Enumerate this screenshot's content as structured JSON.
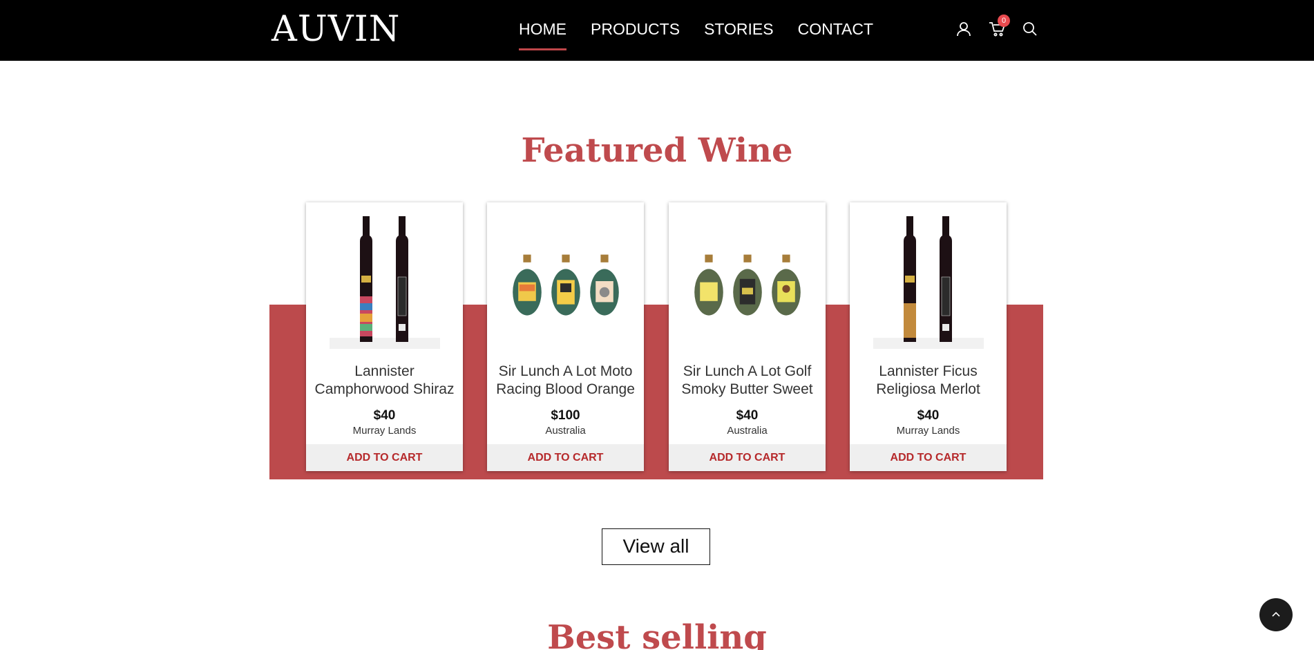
{
  "brand": {
    "logo": "AUVIN"
  },
  "nav": {
    "items": [
      {
        "label": "HOME",
        "active": true
      },
      {
        "label": "PRODUCTS",
        "active": false
      },
      {
        "label": "STORIES",
        "active": false
      },
      {
        "label": "CONTACT",
        "active": false
      }
    ]
  },
  "header_icons": {
    "account": "user-icon",
    "cart": "cart-icon",
    "cart_count": "0",
    "search": "search-icon"
  },
  "featured": {
    "title": "Featured Wine",
    "products": [
      {
        "name": "Lannister Camphorwood Shiraz",
        "price": "$40",
        "origin": "Murray Lands",
        "button": "ADD TO CART",
        "image": "wine-bottles-colorful-label"
      },
      {
        "name": "Sir Lunch A Lot Moto Racing Blood Orange",
        "price": "$100",
        "origin": "Australia",
        "button": "ADD TO CART",
        "image": "gin-bottles"
      },
      {
        "name": "Sir Lunch A Lot Golf Smoky Butter Sweet",
        "price": "$40",
        "origin": "Australia",
        "button": "ADD TO CART",
        "image": "gin-bottles"
      },
      {
        "name": "Lannister Ficus Religiosa Merlot",
        "price": "$40",
        "origin": "Murray Lands",
        "button": "ADD TO CART",
        "image": "wine-bottles-gold-label"
      }
    ],
    "view_all": "View all"
  },
  "best_selling": {
    "title": "Best selling"
  },
  "colors": {
    "accent": "#bf4a4d",
    "band": "#bc4a4c",
    "header_bg": "#000000",
    "button_text": "#b6292b",
    "badge": "#e84a4f"
  }
}
